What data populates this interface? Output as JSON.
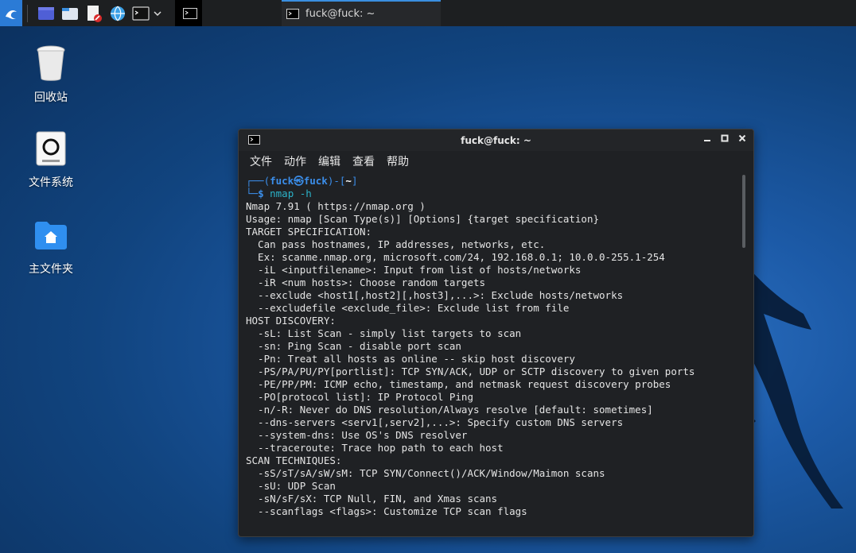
{
  "taskbar": {
    "terminal_task_label": "fuck@fuck: ~"
  },
  "desktop": {
    "icons": [
      {
        "label": "回收站",
        "icon": "trash-icon"
      },
      {
        "label": "文件系统",
        "icon": "drive-icon"
      },
      {
        "label": "主文件夹",
        "icon": "home-folder-icon"
      }
    ]
  },
  "terminal": {
    "title": "fuck@fuck: ~",
    "menu": [
      "文件",
      "动作",
      "编辑",
      "查看",
      "帮助"
    ],
    "prompt": {
      "open": "┌──(",
      "user": "fuck㉿fuck",
      "mid": ")-[",
      "dir": "~",
      "close": "]",
      "prefix": "└─",
      "symbol": "$",
      "command": "nmap -h"
    },
    "output": [
      "Nmap 7.91 ( https://nmap.org )",
      "Usage: nmap [Scan Type(s)] [Options] {target specification}",
      "TARGET SPECIFICATION:",
      "  Can pass hostnames, IP addresses, networks, etc.",
      "  Ex: scanme.nmap.org, microsoft.com/24, 192.168.0.1; 10.0.0-255.1-254",
      "  -iL <inputfilename>: Input from list of hosts/networks",
      "  -iR <num hosts>: Choose random targets",
      "  --exclude <host1[,host2][,host3],...>: Exclude hosts/networks",
      "  --excludefile <exclude_file>: Exclude list from file",
      "HOST DISCOVERY:",
      "  -sL: List Scan - simply list targets to scan",
      "  -sn: Ping Scan - disable port scan",
      "  -Pn: Treat all hosts as online -- skip host discovery",
      "  -PS/PA/PU/PY[portlist]: TCP SYN/ACK, UDP or SCTP discovery to given ports",
      "  -PE/PP/PM: ICMP echo, timestamp, and netmask request discovery probes",
      "  -PO[protocol list]: IP Protocol Ping",
      "  -n/-R: Never do DNS resolution/Always resolve [default: sometimes]",
      "  --dns-servers <serv1[,serv2],...>: Specify custom DNS servers",
      "  --system-dns: Use OS's DNS resolver",
      "  --traceroute: Trace hop path to each host",
      "SCAN TECHNIQUES:",
      "  -sS/sT/sA/sW/sM: TCP SYN/Connect()/ACK/Window/Maimon scans",
      "  -sU: UDP Scan",
      "  -sN/sF/sX: TCP Null, FIN, and Xmas scans",
      "  --scanflags <flags>: Customize TCP scan flags"
    ]
  }
}
